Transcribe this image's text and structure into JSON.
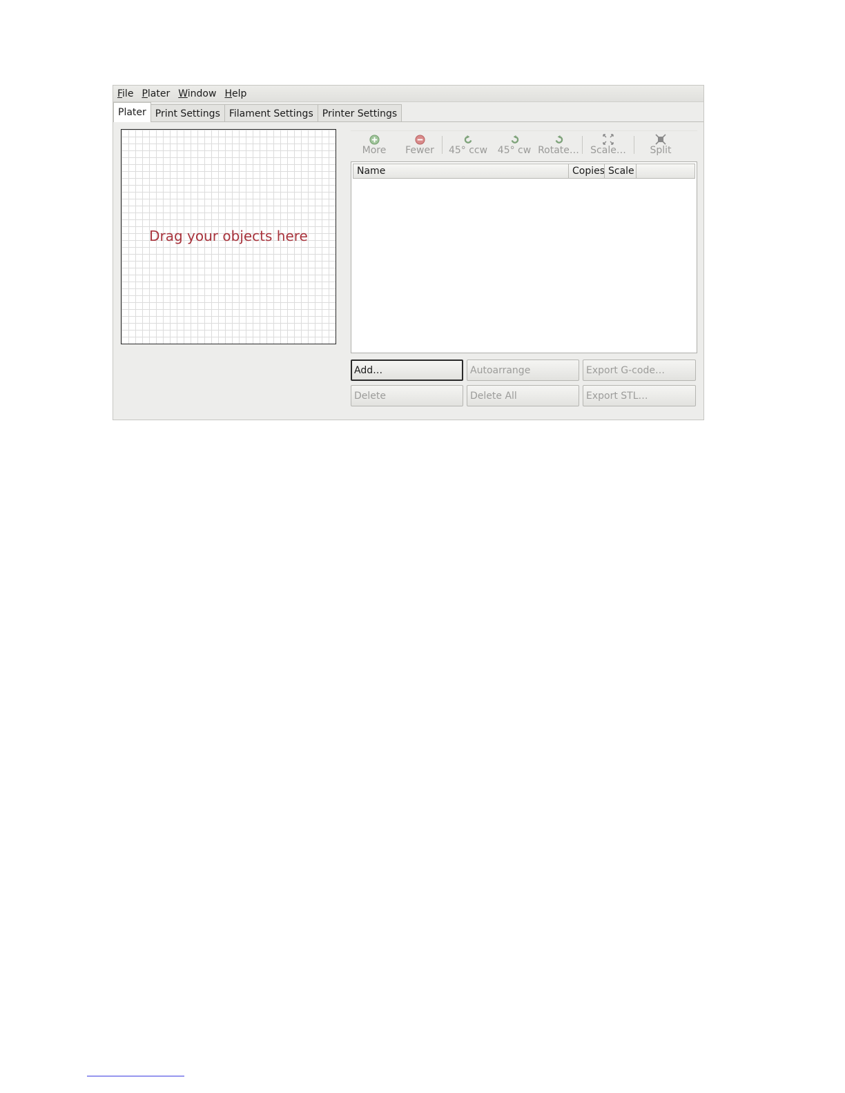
{
  "menubar": {
    "items": [
      {
        "label": "File",
        "mnemonic": "F"
      },
      {
        "label": "Plater",
        "mnemonic": "P"
      },
      {
        "label": "Window",
        "mnemonic": "W"
      },
      {
        "label": "Help",
        "mnemonic": "H"
      }
    ]
  },
  "tabs": [
    {
      "label": "Plater",
      "active": true
    },
    {
      "label": "Print Settings",
      "active": false
    },
    {
      "label": "Filament Settings",
      "active": false
    },
    {
      "label": "Printer Settings",
      "active": false
    }
  ],
  "canvas": {
    "hint": "Drag your objects here",
    "hint_color": "#a8343d"
  },
  "toolbar": {
    "more": "More",
    "fewer": "Fewer",
    "rotate_ccw": "45° ccw",
    "rotate_cw": "45° cw",
    "rotate": "Rotate…",
    "scale": "Scale…",
    "split": "Split"
  },
  "object_list": {
    "columns": [
      "Name",
      "Copies",
      "Scale",
      ""
    ],
    "rows": []
  },
  "buttons": {
    "add": "Add…",
    "autoarrange": "Autoarrange",
    "export_gcode": "Export G-code…",
    "delete": "Delete",
    "delete_all": "Delete All",
    "export_stl": "Export STL…"
  }
}
